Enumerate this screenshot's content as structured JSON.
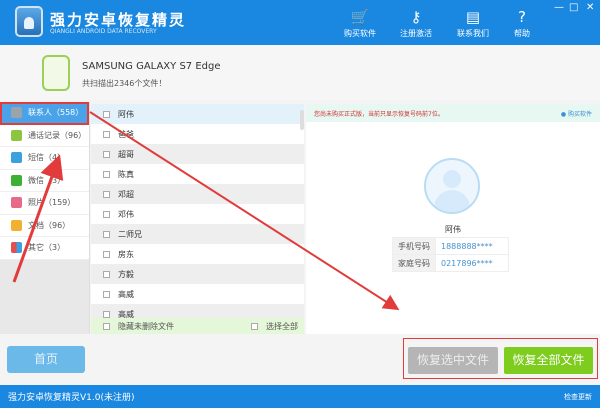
{
  "header": {
    "title": "强力安卓恢复精灵",
    "subtitle": "QIANGLI ANDROID DATA RECOVERY",
    "buttons": [
      {
        "label": "购买软件",
        "icon": "cart-icon"
      },
      {
        "label": "注册激活",
        "icon": "key-icon"
      },
      {
        "label": "联系我们",
        "icon": "chat-icon"
      },
      {
        "label": "帮助",
        "icon": "help-icon"
      }
    ],
    "window": {
      "minimize": "—",
      "maximize": "□",
      "close": "✕"
    }
  },
  "device": {
    "name": "SAMSUNG  GALAXY S7 Edge",
    "scan_result": "共扫描出2346个文件！"
  },
  "sidebar": {
    "items": [
      {
        "label": "联系人（558）",
        "color": "#9aa4ad"
      },
      {
        "label": "通话记录（96）",
        "color": "#8cc63f"
      },
      {
        "label": "短信（4）",
        "color": "#3aa0e0"
      },
      {
        "label": "微信（3）",
        "color": "#3cb034"
      },
      {
        "label": "照片（159）",
        "color": "#e86a8a"
      },
      {
        "label": "文档（96）",
        "color": "#f0b030"
      },
      {
        "label": "其它（3）",
        "color": "#e24f4f"
      }
    ]
  },
  "list": {
    "items": [
      "阿伟",
      "爸爸",
      "超哥",
      "陈真",
      "邓超",
      "邓伟",
      "二师兄",
      "房东",
      "方毅",
      "高威",
      "高威"
    ],
    "hide_undeleted": "隐藏未删除文件",
    "select_all": "选择全部"
  },
  "detail": {
    "notice": "您尚未购买正式版，当前只显示恢复号码前7位。",
    "buy_link": "购买软件",
    "name": "阿伟",
    "fields": [
      {
        "label": "手机号码",
        "value": "1888888****"
      },
      {
        "label": "家庭号码",
        "value": "0217896****"
      }
    ]
  },
  "footer": {
    "home": "首页",
    "recover_selected": "恢复选中文件",
    "recover_all": "恢复全部文件"
  },
  "status": {
    "version": "强力安卓恢复精灵V1.0(未注册)",
    "check_update": "检查更新"
  }
}
